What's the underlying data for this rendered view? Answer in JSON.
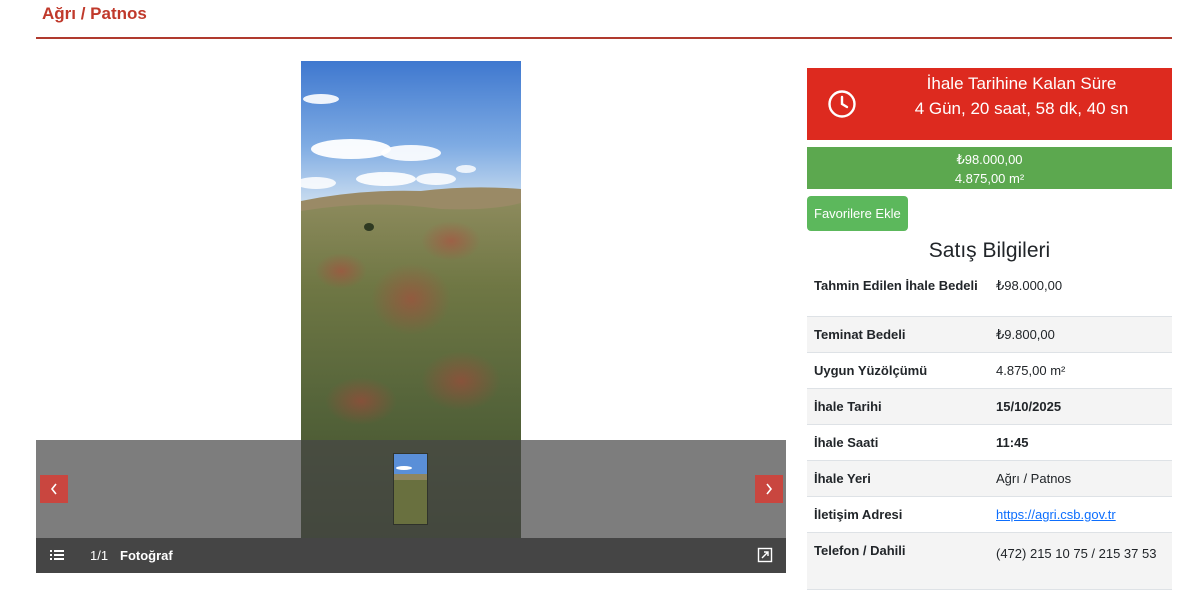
{
  "page": {
    "title": "Ağrı / Patnos"
  },
  "gallery": {
    "counter": "1/1",
    "counter_label": "Fotoğraf",
    "prev_icon": "chevron-left-icon",
    "next_icon": "chevron-right-icon",
    "menu_icon": "list-icon",
    "fullscreen_icon": "fullscreen-icon"
  },
  "auction": {
    "timer_title": "İhale Tarihine Kalan Süre",
    "timer_value": "4 Gün, 20 saat, 58 dk, 40 sn",
    "price": "₺98.000,00",
    "area": "4.875,00 m²",
    "favorite_label": "Favorilere Ekle",
    "colors": {
      "timer_bg": "#dd2a1f",
      "price_bg": "#5ca84f",
      "accent": "#c0392b"
    }
  },
  "sales": {
    "title": "Satış Bilgileri",
    "rows": [
      {
        "key": "Tahmin Edilen İhale Bedeli",
        "value": "₺98.000,00"
      },
      {
        "key": "Teminat Bedeli",
        "value": "₺9.800,00"
      },
      {
        "key": "Uygun Yüzölçümü",
        "value": "4.875,00 m²"
      },
      {
        "key": "İhale Tarihi",
        "value": "15/10/2025"
      },
      {
        "key": "İhale Saati",
        "value": "11:45"
      },
      {
        "key": "İhale Yeri",
        "value": "Ağrı / Patnos"
      },
      {
        "key": "İletişim Adresi",
        "value": "https://agri.csb.gov.tr"
      },
      {
        "key": "Telefon / Dahili",
        "value": "(472) 215 10 75 / 215 37 53"
      }
    ]
  }
}
